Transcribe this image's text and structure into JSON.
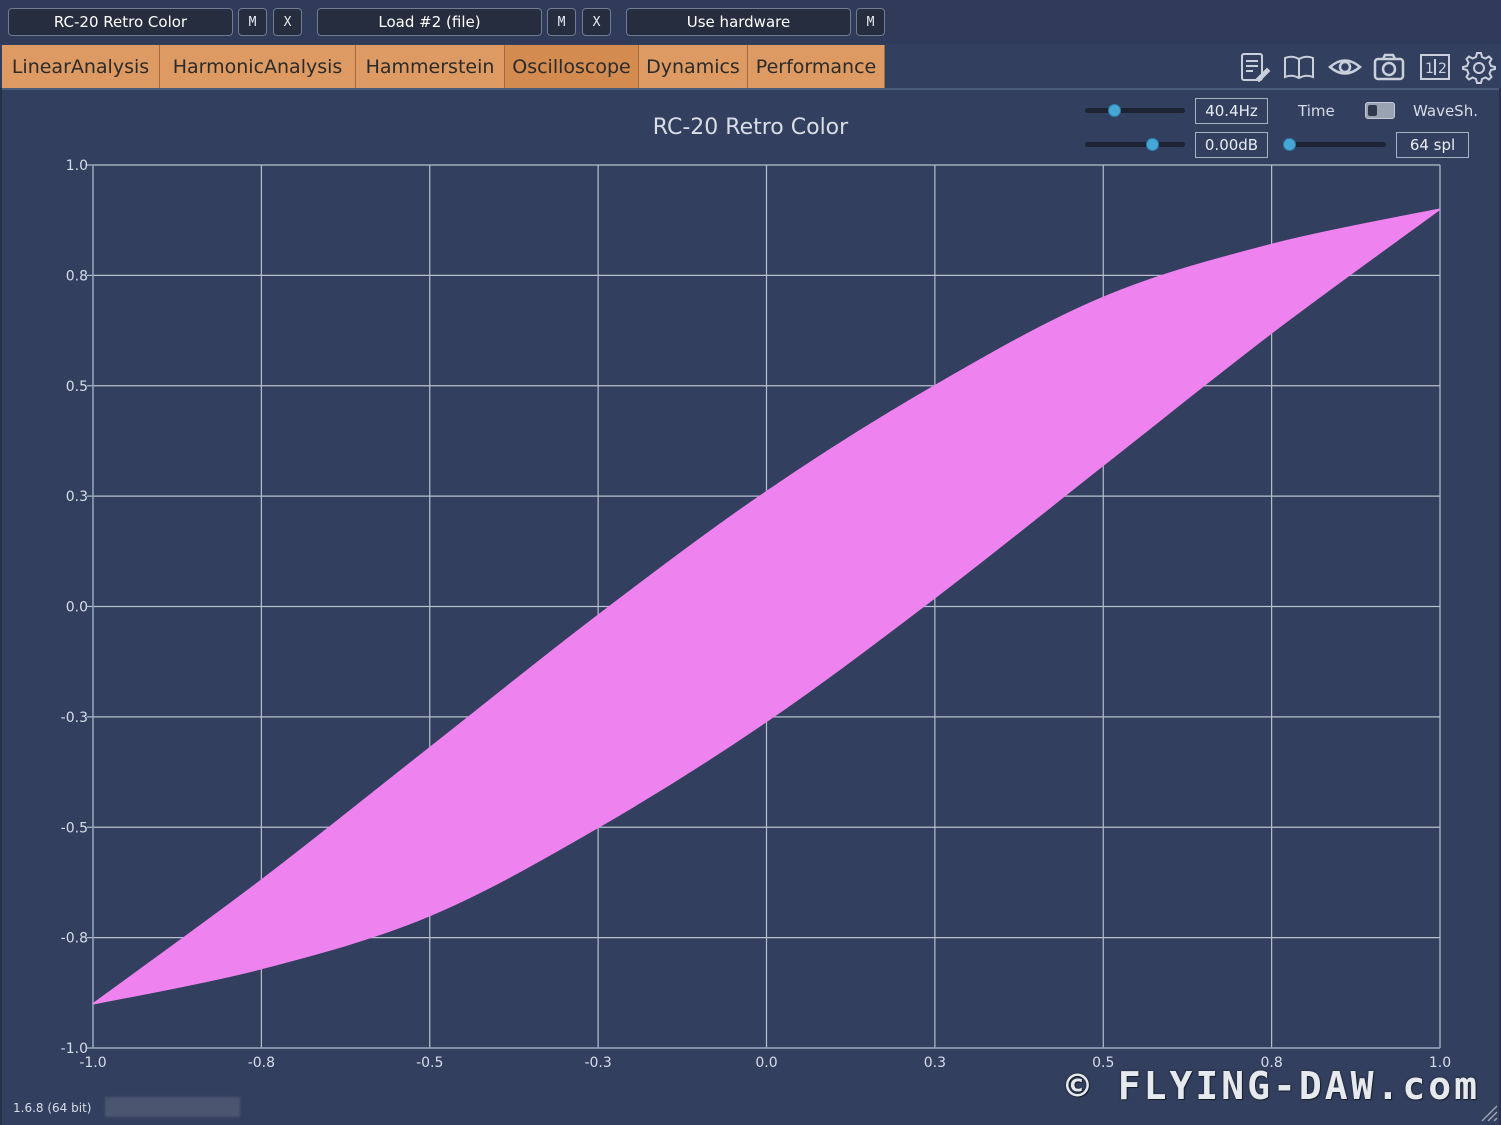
{
  "topbar": {
    "slot1": {
      "label": "RC-20 Retro Color",
      "m": "M",
      "x": "X"
    },
    "slot2": {
      "label": "Load #2 (file)",
      "m": "M",
      "x": "X"
    },
    "slot3": {
      "label": "Use hardware",
      "m": "M"
    }
  },
  "tabs": [
    {
      "label": "LinearAnalysis"
    },
    {
      "label": "HarmonicAnalysis"
    },
    {
      "label": "Hammerstein"
    },
    {
      "label": "Oscilloscope"
    },
    {
      "label": "Dynamics"
    },
    {
      "label": "Performance"
    }
  ],
  "active_tab": "Oscilloscope",
  "toolbar_icons": [
    "notes-icon",
    "manual-book-icon",
    "eye-icon",
    "camera-icon",
    "split-1-2-icon",
    "settings-gear-icon"
  ],
  "controls": {
    "frequency": {
      "value": "40.4Hz",
      "slider_fraction": 0.26
    },
    "gain": {
      "value": "0.00dB",
      "slider_fraction": 0.7
    },
    "time_label": "Time",
    "waveshape_label": "WaveSh.",
    "samples": {
      "value": "64 spl",
      "slider_fraction": 0.0
    }
  },
  "plot_title": "RC-20 Retro Color",
  "chart_data": {
    "type": "scatter",
    "title": "RC-20 Retro Color",
    "xlim": [
      -1.0,
      1.0
    ],
    "ylim": [
      -1.0,
      1.0
    ],
    "x_ticks": [
      "-1.0",
      "-0.8",
      "-0.5",
      "-0.3",
      "0.0",
      "0.3",
      "0.5",
      "0.8",
      "1.0"
    ],
    "y_ticks": [
      "1.0",
      "0.8",
      "0.5",
      "0.3",
      "0.0",
      "-0.3",
      "-0.5",
      "-0.8",
      "-1.0"
    ],
    "grid": true,
    "series": [
      {
        "color": "#ee82ee",
        "shape": "filled lissajous loop",
        "upper_edge": [
          [
            -1.0,
            -0.9
          ],
          [
            -0.75,
            -0.62
          ],
          [
            -0.5,
            -0.32
          ],
          [
            -0.25,
            -0.02
          ],
          [
            0.0,
            0.26
          ],
          [
            0.25,
            0.5
          ],
          [
            0.5,
            0.7
          ],
          [
            0.75,
            0.82
          ],
          [
            1.0,
            0.9
          ]
        ],
        "lower_edge": [
          [
            -1.0,
            -0.9
          ],
          [
            -0.75,
            -0.82
          ],
          [
            -0.5,
            -0.7
          ],
          [
            -0.25,
            -0.5
          ],
          [
            0.0,
            -0.26
          ],
          [
            0.25,
            0.02
          ],
          [
            0.5,
            0.32
          ],
          [
            0.75,
            0.62
          ],
          [
            1.0,
            0.9
          ]
        ]
      }
    ]
  },
  "footer": {
    "version": "1.6.8 (64 bit)",
    "watermark": "© FLYING-DAW.com"
  }
}
